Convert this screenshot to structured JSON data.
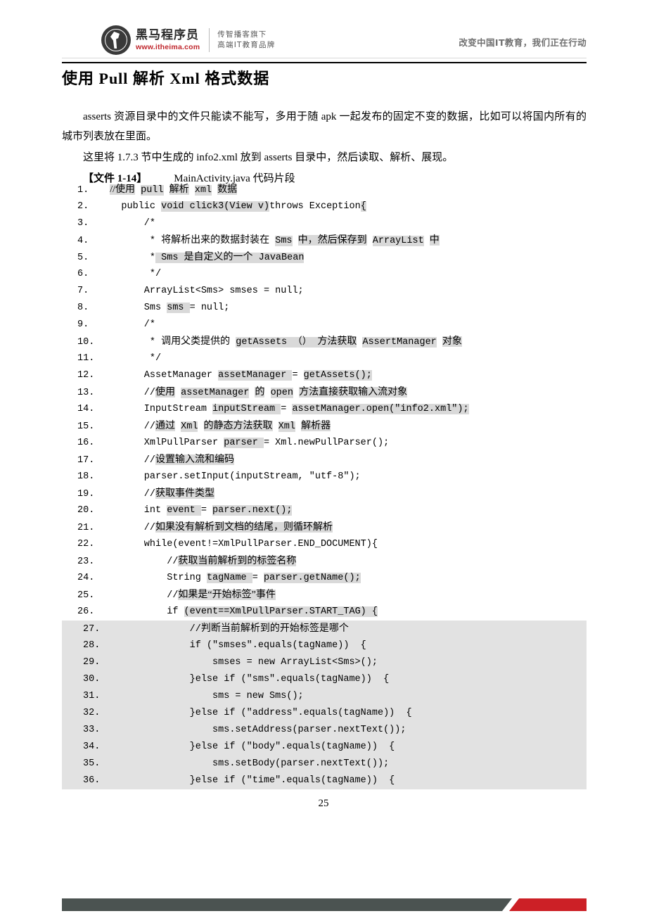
{
  "header": {
    "logo_cn": "黑马程序员",
    "logo_url": "www.itheima.com",
    "slogan_line1": "传智播客旗下",
    "slogan_line2": "高端IT教育品牌",
    "right_text": "改变中国IT教育，我们正在行动"
  },
  "title": "使用 Pull 解析 Xml 格式数据",
  "paragraphs": {
    "p1": "asserts 资源目录中的文件只能读不能写，多用于随 apk 一起发布的固定不变的数据，比如可以将国内所有的城市列表放在里面。",
    "p2": "这里将 1.7.3 节中生成的 info2.xml 放到 asserts 目录中，然后读取、解析、展现。",
    "file_label": "【文件 1-14】",
    "file_caption": "MainActivity.java 代码片段"
  },
  "code": {
    "lines": [
      {
        "n": "1.",
        "shaded": false
      },
      {
        "n": "2.",
        "shaded": false
      },
      {
        "n": "3.",
        "shaded": false
      },
      {
        "n": "4.",
        "shaded": false
      },
      {
        "n": "5.",
        "shaded": false
      },
      {
        "n": "6.",
        "shaded": false
      },
      {
        "n": "7.",
        "shaded": false
      },
      {
        "n": "8.",
        "shaded": false
      },
      {
        "n": "9.",
        "shaded": false
      },
      {
        "n": "10.",
        "shaded": false
      },
      {
        "n": "11.",
        "shaded": false
      },
      {
        "n": "12.",
        "shaded": false
      },
      {
        "n": "13.",
        "shaded": false
      },
      {
        "n": "14.",
        "shaded": false
      },
      {
        "n": "15.",
        "shaded": false
      },
      {
        "n": "16.",
        "shaded": false
      },
      {
        "n": "17.",
        "shaded": false
      },
      {
        "n": "18.",
        "shaded": false
      },
      {
        "n": "19.",
        "shaded": false
      },
      {
        "n": "20.",
        "shaded": false
      },
      {
        "n": "21.",
        "shaded": false
      },
      {
        "n": "22.",
        "shaded": false
      },
      {
        "n": "23.",
        "shaded": false
      },
      {
        "n": "24.",
        "shaded": false
      },
      {
        "n": "25.",
        "shaded": false
      },
      {
        "n": "26.",
        "shaded": false
      },
      {
        "n": "27.",
        "shaded": true
      },
      {
        "n": "28.",
        "shaded": true
      },
      {
        "n": "29.",
        "shaded": true
      },
      {
        "n": "30.",
        "shaded": true
      },
      {
        "n": "31.",
        "shaded": true
      },
      {
        "n": "32.",
        "shaded": true
      },
      {
        "n": "33.",
        "shaded": true
      },
      {
        "n": "34.",
        "shaded": true
      },
      {
        "n": "35.",
        "shaded": true
      },
      {
        "n": "36.",
        "shaded": true
      }
    ],
    "text": {
      "l1": "  //使用 pull 解析 xml 数据",
      "l2": "    public void click3(View v)throws Exception{",
      "l3": "        /*",
      "l4": "         * 将解析出来的数据封装在 Sms 中，然后保存到 ArrayList 中",
      "l5": "         * Sms 是自定义的一个 JavaBean",
      "l6": "         */",
      "l7": "        ArrayList<Sms> smses = null;",
      "l8": "        Sms sms = null;",
      "l9": "        /*",
      "l10": "         * 调用父类提供的 getAssets () 方法获取 AssertManager 对象",
      "l11": "         */",
      "l12": "        AssetManager assetManager = getAssets();",
      "l13": "        //使用 assetManager 的 open 方法直接获取输入流对象",
      "l14": "        InputStream inputStream = assetManager.open(\"info2.xml\");",
      "l15": "        //通过 Xml 的静态方法获取 Xml 解析器",
      "l16": "        XmlPullParser parser = Xml.newPullParser();",
      "l17": "        //设置输入流和编码",
      "l18": "        parser.setInput(inputStream, \"utf-8\");",
      "l19": "        //获取事件类型",
      "l20": "        int event = parser.next();",
      "l21": "        //如果没有解析到文档的结尾，则循环解析",
      "l22": "        while(event!=XmlPullParser.END_DOCUMENT){",
      "l23": "            //获取当前解析到的标签名称",
      "l24": "            String tagName = parser.getName();",
      "l25": "            //如果是“开始标签”事件",
      "l26": "            if (event==XmlPullParser.START_TAG) {",
      "l27": "                //判断当前解析到的开始标签是哪个",
      "l28": "                if (\"smses\".equals(tagName))  {",
      "l29": "                    smses = new ArrayList<Sms>();",
      "l30": "                }else if (\"sms\".equals(tagName))  {",
      "l31": "                    sms = new Sms();",
      "l32": "                }else if (\"address\".equals(tagName))  {",
      "l33": "                    sms.setAddress(parser.nextText());",
      "l34": "                }else if (\"body\".equals(tagName))  {",
      "l35": "                    sms.setBody(parser.nextText());",
      "l36": "                }else if (\"time\".equals(tagName))  {"
    }
  },
  "page_number": "25"
}
